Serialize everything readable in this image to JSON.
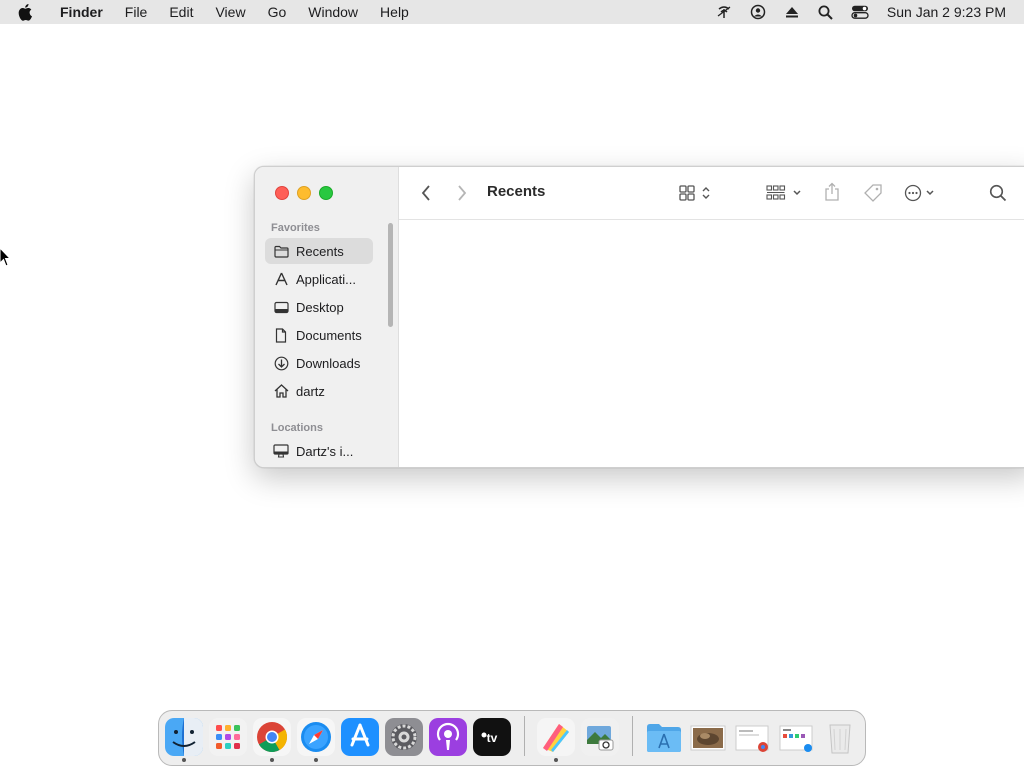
{
  "menubar": {
    "app_name": "Finder",
    "items": [
      "File",
      "Edit",
      "View",
      "Go",
      "Window",
      "Help"
    ],
    "clock": "Sun Jan 2  9:23 PM"
  },
  "window": {
    "title": "Recents",
    "sidebar": {
      "favorites_heading": "Favorites",
      "locations_heading": "Locations",
      "items": [
        {
          "label": "Recents",
          "icon": "folder-icon",
          "selected": true
        },
        {
          "label": "Applicati...",
          "icon": "applications-icon"
        },
        {
          "label": "Desktop",
          "icon": "desktop-icon"
        },
        {
          "label": "Documents",
          "icon": "document-icon"
        },
        {
          "label": "Downloads",
          "icon": "downloads-icon"
        },
        {
          "label": "dartz",
          "icon": "home-icon"
        }
      ],
      "locations": [
        {
          "label": "Dartz's i...",
          "icon": "computer-icon"
        }
      ]
    }
  },
  "dock": {
    "apps": [
      "Finder",
      "Launchpad",
      "Google Chrome",
      "Safari",
      "App Store",
      "System Preferences",
      "Podcasts",
      "Apple TV",
      "Pixelmator",
      "Preview",
      "Applications",
      "Photo",
      "Document",
      "Screenshot",
      "Trash"
    ]
  },
  "colors": {
    "close": "#ff5f57",
    "minimize": "#febc2e",
    "maximize": "#28c840",
    "menubar": "#e6e6e6"
  }
}
